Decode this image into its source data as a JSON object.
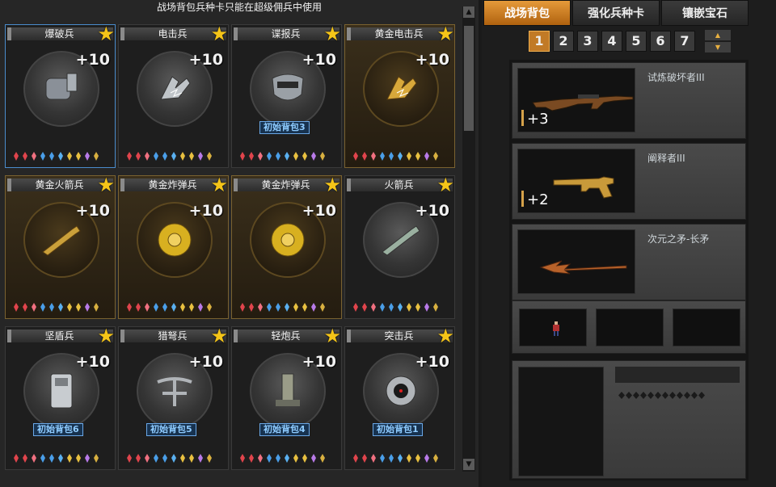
{
  "notice": "战场背包兵种卡只能在超级佣兵中使用",
  "cards": [
    {
      "name": "爆破兵",
      "plus": "+10",
      "tag": "",
      "icon": "demolition-pack-icon"
    },
    {
      "name": "电击兵",
      "plus": "+10",
      "tag": "",
      "icon": "electric-claw-icon"
    },
    {
      "name": "谍报兵",
      "plus": "+10",
      "tag": "初始背包3",
      "icon": "spy-mask-icon"
    },
    {
      "name": "黄金电击兵",
      "plus": "+10",
      "tag": "",
      "icon": "gold-electric-claw-icon"
    },
    {
      "name": "黄金火箭兵",
      "plus": "+10",
      "tag": "",
      "icon": "gold-rocket-launcher-icon"
    },
    {
      "name": "黄金炸弹兵",
      "plus": "+10",
      "tag": "",
      "icon": "gold-bomb-icon"
    },
    {
      "name": "黄金炸弹兵",
      "plus": "+10",
      "tag": "",
      "icon": "gold-bomb-icon"
    },
    {
      "name": "火箭兵",
      "plus": "+10",
      "tag": "",
      "icon": "rocket-launcher-icon"
    },
    {
      "name": "坚盾兵",
      "plus": "+10",
      "tag": "初始背包6",
      "icon": "riot-shield-icon"
    },
    {
      "name": "猎弩兵",
      "plus": "+10",
      "tag": "初始背包5",
      "icon": "crossbow-icon"
    },
    {
      "name": "轻炮兵",
      "plus": "+10",
      "tag": "初始背包4",
      "icon": "mortar-icon"
    },
    {
      "name": "突击兵",
      "plus": "+10",
      "tag": "初始背包1",
      "icon": "assault-scope-icon"
    }
  ],
  "gem_colors": [
    "#e0444c",
    "#e0444c",
    "#f07080",
    "#4a9ee8",
    "#4a9ee8",
    "#5ab0f0",
    "#e8c040",
    "#e8c040",
    "#b87ae8",
    "#d8b040"
  ],
  "tabs": [
    "战场背包",
    "强化兵种卡",
    "镶嵌宝石"
  ],
  "pages": [
    "1",
    "2",
    "3",
    "4",
    "5",
    "6",
    "7"
  ],
  "active_page": "1",
  "weapons": [
    {
      "name": "试炼破坏者III",
      "ammo": "+3",
      "icon": "sniper-rifle-icon"
    },
    {
      "name": "阐释者III",
      "ammo": "+2",
      "icon": "gold-revolver-icon"
    },
    {
      "name": "次元之矛-长矛",
      "ammo": "",
      "icon": "spear-icon"
    }
  ],
  "colors": {
    "accent": "#c17a26",
    "star": "#f5c518",
    "tag": "#8ecbff",
    "selected_border": "#4a8ccc"
  }
}
